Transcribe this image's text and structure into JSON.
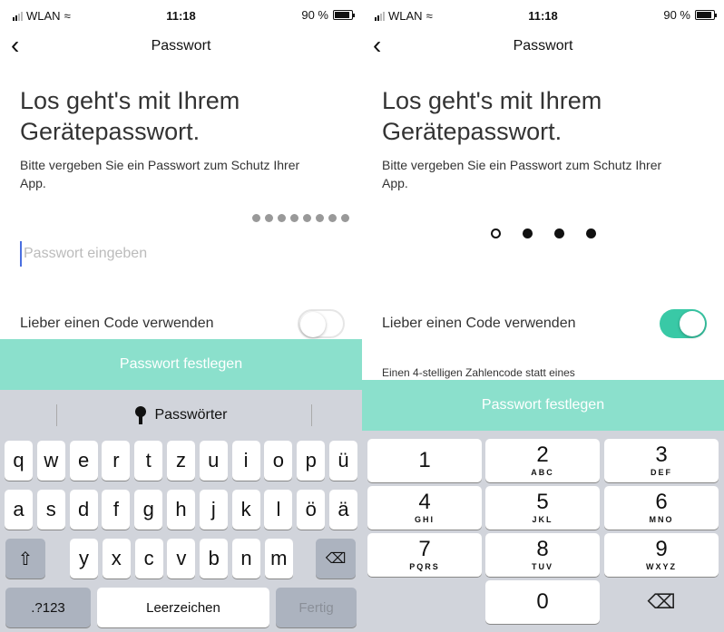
{
  "status": {
    "carrier": "WLAN",
    "time": "11:18",
    "battery": "90 %"
  },
  "left": {
    "nav_title": "Passwort",
    "heading_line1": "Los geht's mit Ihrem",
    "heading_line2": "Gerätepasswort.",
    "subtitle": "Bitte vergeben Sie ein Passwort zum Schutz Ihrer App.",
    "password_dots_count": 8,
    "password_placeholder": "Passwort eingeben",
    "toggle_label": "Lieber einen Code verwenden",
    "toggle_on": false,
    "primary_button": "Passwort festlegen",
    "keyboard": {
      "suggestion": "Passwörter",
      "row1": [
        "q",
        "w",
        "e",
        "r",
        "t",
        "z",
        "u",
        "i",
        "o",
        "p",
        "ü"
      ],
      "row2": [
        "a",
        "s",
        "d",
        "f",
        "g",
        "h",
        "j",
        "k",
        "l",
        "ö",
        "ä"
      ],
      "row3": [
        "y",
        "x",
        "c",
        "v",
        "b",
        "n",
        "m"
      ],
      "numbers_key": ".?123",
      "space_key": "Leerzeichen",
      "done_key": "Fertig"
    }
  },
  "right": {
    "nav_title": "Passwort",
    "heading_line1": "Los geht's mit Ihrem",
    "heading_line2": "Gerätepasswort.",
    "subtitle": "Bitte vergeben Sie ein Passwort zum Schutz Ihrer App.",
    "code_filled": 3,
    "code_length": 4,
    "toggle_label": "Lieber einen Code verwenden",
    "toggle_on": true,
    "hint": "Einen 4-stelligen Zahlencode statt eines",
    "primary_button": "Passwort festlegen",
    "numpad": [
      {
        "digit": "1",
        "letters": ""
      },
      {
        "digit": "2",
        "letters": "ABC"
      },
      {
        "digit": "3",
        "letters": "DEF"
      },
      {
        "digit": "4",
        "letters": "GHI"
      },
      {
        "digit": "5",
        "letters": "JKL"
      },
      {
        "digit": "6",
        "letters": "MNO"
      },
      {
        "digit": "7",
        "letters": "PQRS"
      },
      {
        "digit": "8",
        "letters": "TUV"
      },
      {
        "digit": "9",
        "letters": "WXYZ"
      },
      {
        "digit": "0",
        "letters": ""
      }
    ]
  },
  "colors": {
    "accent": "#39c9a6",
    "button": "#8be0cc",
    "keyboard_bg": "#d1d4db",
    "cursor": "#4a6fe0"
  }
}
